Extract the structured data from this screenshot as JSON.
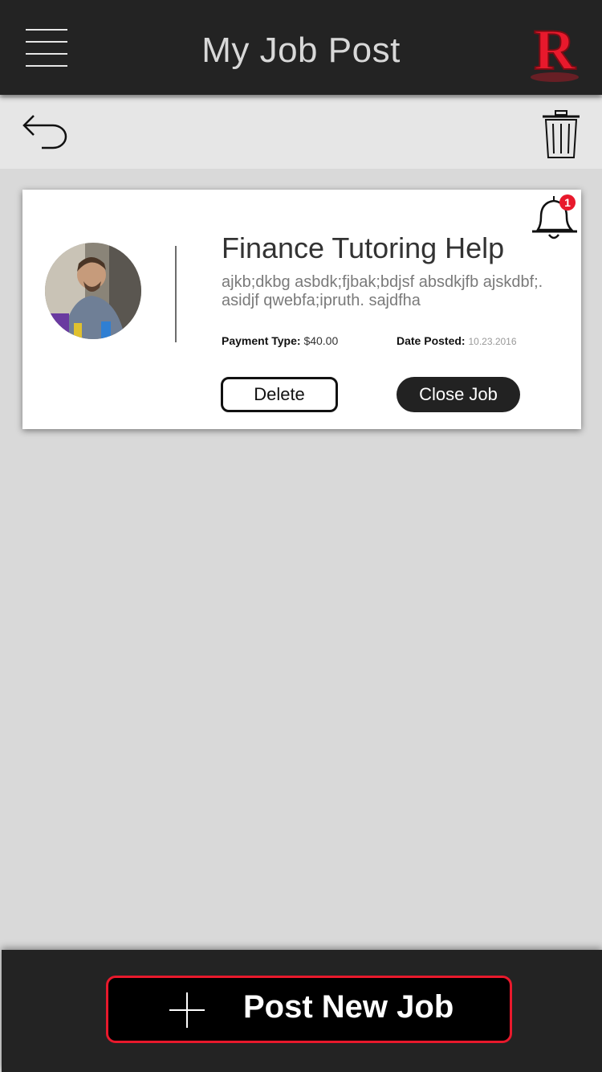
{
  "header": {
    "title": "My Job Post",
    "menu_icon": "hamburger-menu-icon",
    "logo_letter": "R",
    "logo_color": "#e8192c"
  },
  "toolbar": {
    "back_icon": "undo-arrow-icon",
    "trash_icon": "trash-icon"
  },
  "job_card": {
    "title": "Finance Tutoring Help",
    "description": "ajkb;dkbg asbdk;fjbak;bdjsf absdkjfb ajskdbf;. asidjf qwebfa;ipruth. sajdfha",
    "payment_label": "Payment Type:",
    "payment_value": "$40.00",
    "date_label": "Date Posted:",
    "date_value": "10.23.2016",
    "notification_count": "1",
    "notification_icon": "bell-icon",
    "delete_label": "Delete",
    "close_label": "Close Job"
  },
  "footer": {
    "post_label": "Post New Job",
    "post_icon": "plus-icon",
    "accent_color": "#e8192c"
  }
}
